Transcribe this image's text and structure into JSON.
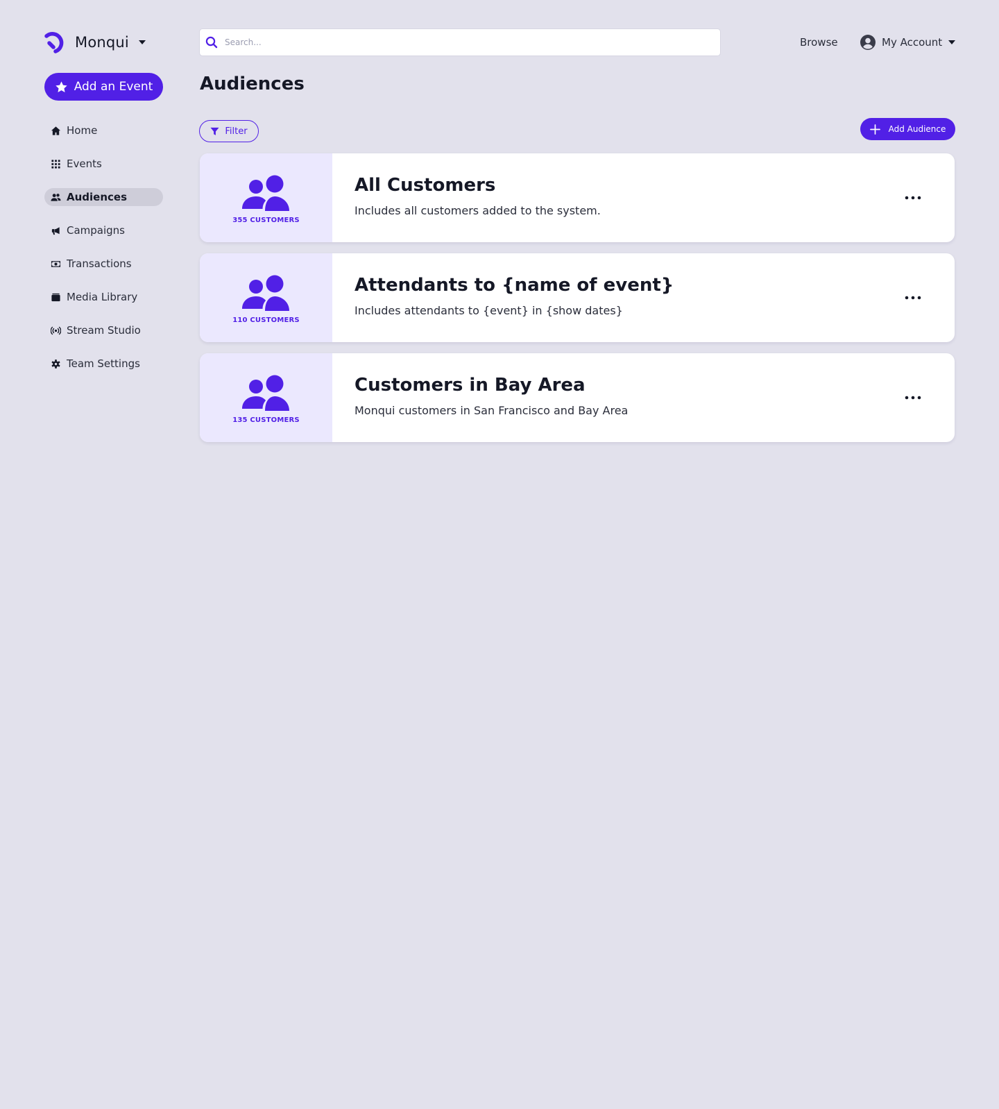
{
  "brand": {
    "name": "Monqui",
    "logo_icon": "monqui-logo-icon"
  },
  "colors": {
    "accent": "#5120e6",
    "background": "#e2e1ec",
    "card_left_bg": "#ebe8fe",
    "text": "#151826"
  },
  "actions": {
    "add_event_label": "Add an Event"
  },
  "sidebar": {
    "items": [
      {
        "label": "Home",
        "icon": "home-icon",
        "active": false
      },
      {
        "label": "Events",
        "icon": "grid-icon",
        "active": false
      },
      {
        "label": "Audiences",
        "icon": "users-icon",
        "active": true
      },
      {
        "label": "Campaigns",
        "icon": "megaphone-icon",
        "active": false
      },
      {
        "label": "Transactions",
        "icon": "money-icon",
        "active": false
      },
      {
        "label": "Media Library",
        "icon": "folder-icon",
        "active": false
      },
      {
        "label": "Stream Studio",
        "icon": "broadcast-icon",
        "active": false
      },
      {
        "label": "Team Settings",
        "icon": "gear-icon",
        "active": false
      }
    ]
  },
  "header": {
    "search": {
      "placeholder": "Search...",
      "value": ""
    },
    "browse_label": "Browse",
    "account_label": "My Account"
  },
  "page": {
    "title": "Audiences",
    "filter_label": "Filter",
    "add_audience_label": "Add Audience"
  },
  "audiences": [
    {
      "count_label": "355 CUSTOMERS",
      "title": "All Customers",
      "description": "Includes all customers added to the system."
    },
    {
      "count_label": "110 CUSTOMERS",
      "title": "Attendants to {name of event}",
      "description": "Includes attendants to {event} in {show dates}"
    },
    {
      "count_label": "135 CUSTOMERS",
      "title": "Customers in Bay Area",
      "description": "Monqui customers in San Francisco and Bay Area"
    }
  ]
}
